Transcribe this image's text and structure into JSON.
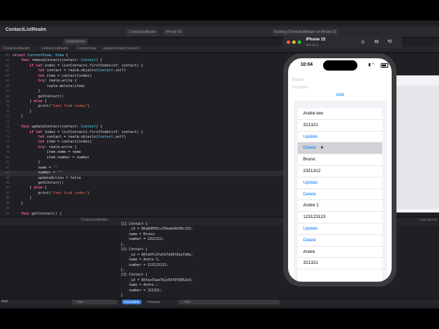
{
  "xcode": {
    "project": "ContactListRealm",
    "tabs": [
      "ContactListRealm",
      "iPhone 15",
      "Running ContactListRealm on iPhone 15"
    ],
    "breadcrumbs": [
      "ContactListRealm",
      "ContactListRealm",
      "ContentView",
      "updateContact(contact:)"
    ],
    "open_file": "ContentView",
    "code_lines": [
      {
        "n": "60",
        "t": "struct ContentView: View {"
      },
      {
        "n": "61",
        "t": "    func removeContact(contact: Contact) {"
      },
      {
        "n": "62",
        "t": "        if let index = listContacts.firstIndex(of: contact) {"
      },
      {
        "n": "63",
        "t": "            let contact = realm.objects(Contact.self)"
      },
      {
        "n": "64",
        "t": "            let item = contact[index]"
      },
      {
        "n": "65",
        "t": "            try! realm.write {"
      },
      {
        "n": "66",
        "t": "                realm.delete(item)"
      },
      {
        "n": "67",
        "t": "            }"
      },
      {
        "n": "68",
        "t": "            getContact()"
      },
      {
        "n": "69",
        "t": "        } else {"
      },
      {
        "n": "70",
        "t": "            print(\"Cant find index\")"
      },
      {
        "n": "71",
        "t": "        }"
      },
      {
        "n": "72",
        "t": "    }"
      },
      {
        "n": "73",
        "t": ""
      },
      {
        "n": "74",
        "t": "    func updateContact(contact: Contact) {"
      },
      {
        "n": "75",
        "t": "        if let index = listContacts.firstIndex(of: contact) {"
      },
      {
        "n": "76",
        "t": "            let contact = realm.objects(Contact.self)"
      },
      {
        "n": "77",
        "t": "            let item = contact[index]"
      },
      {
        "n": "78",
        "t": "            try! realm.write {"
      },
      {
        "n": "79",
        "t": "                item.name = name"
      },
      {
        "n": "80",
        "t": "                item.number = number"
      },
      {
        "n": "81",
        "t": "            }"
      },
      {
        "n": "82",
        "t": "            name = \"\""
      },
      {
        "n": "83",
        "t": "            number = \"\""
      },
      {
        "n": "84",
        "t": "            updateAction = false"
      },
      {
        "n": "85",
        "t": "            getContact()"
      },
      {
        "n": "86",
        "t": "        } else {"
      },
      {
        "n": "87",
        "t": "            print(\"Cant find index\")"
      },
      {
        "n": "88",
        "t": "        }"
      },
      {
        "n": "89",
        "t": "    }"
      },
      {
        "n": "90",
        "t": ""
      },
      {
        "n": "91",
        "t": "    func getContact() {"
      },
      {
        "n": "92",
        "t": "        let contact = realm.objects(Contact.self)"
      },
      {
        "n": "93",
        "t": "        print(contact)"
      }
    ],
    "highlighted_line": "83",
    "debug_title": "ContactListRealm",
    "console_lines": [
      "[1] Contact {",
      "    _id = 66a8d093cc25eabe9d30c131;",
      "    name = Bruno;",
      "    number = 2321312;",
      "},",
      "[2] Contact {",
      "    _id = 66fe9fc3fafb7d36f81efb0e;",
      "    name = Andre 1;",
      "    number = 123123123;",
      "},",
      "[3] Contact {",
      "    _id = 66fas55ae7b1c6479f8952e3;",
      "    name = Andre ;",
      "    number = 321321;",
      "}",
      ")"
    ],
    "auto_label": "Auto",
    "filter_placeholder": "Filter",
    "output_tabs": [
      "Executable",
      "Previews"
    ],
    "line_col": "Line: 83  Col"
  },
  "simulator": {
    "device": "iPhone 15",
    "os": "iOS 17.4",
    "time": "10:04",
    "name_placeholder": "Name",
    "number_placeholder": "Number",
    "add_label": "Add",
    "rows": [
      {
        "text": "Andre two",
        "kind": "text"
      },
      {
        "text": "321321",
        "kind": "text"
      },
      {
        "text": "Update",
        "kind": "action"
      },
      {
        "text": "Delete",
        "kind": "action",
        "selected": true
      },
      {
        "text": "Bruno",
        "kind": "text"
      },
      {
        "text": "2321312",
        "kind": "text"
      },
      {
        "text": "Update",
        "kind": "action"
      },
      {
        "text": "Delete",
        "kind": "action"
      },
      {
        "text": "Andre 1",
        "kind": "text"
      },
      {
        "text": "123123123",
        "kind": "text"
      },
      {
        "text": "Update",
        "kind": "action"
      },
      {
        "text": "Delete",
        "kind": "action"
      },
      {
        "text": "Andre",
        "kind": "text"
      },
      {
        "text": "321321",
        "kind": "text"
      }
    ],
    "colors": {
      "accent": "#007aff",
      "selected_row": "#d1d1d6"
    }
  }
}
